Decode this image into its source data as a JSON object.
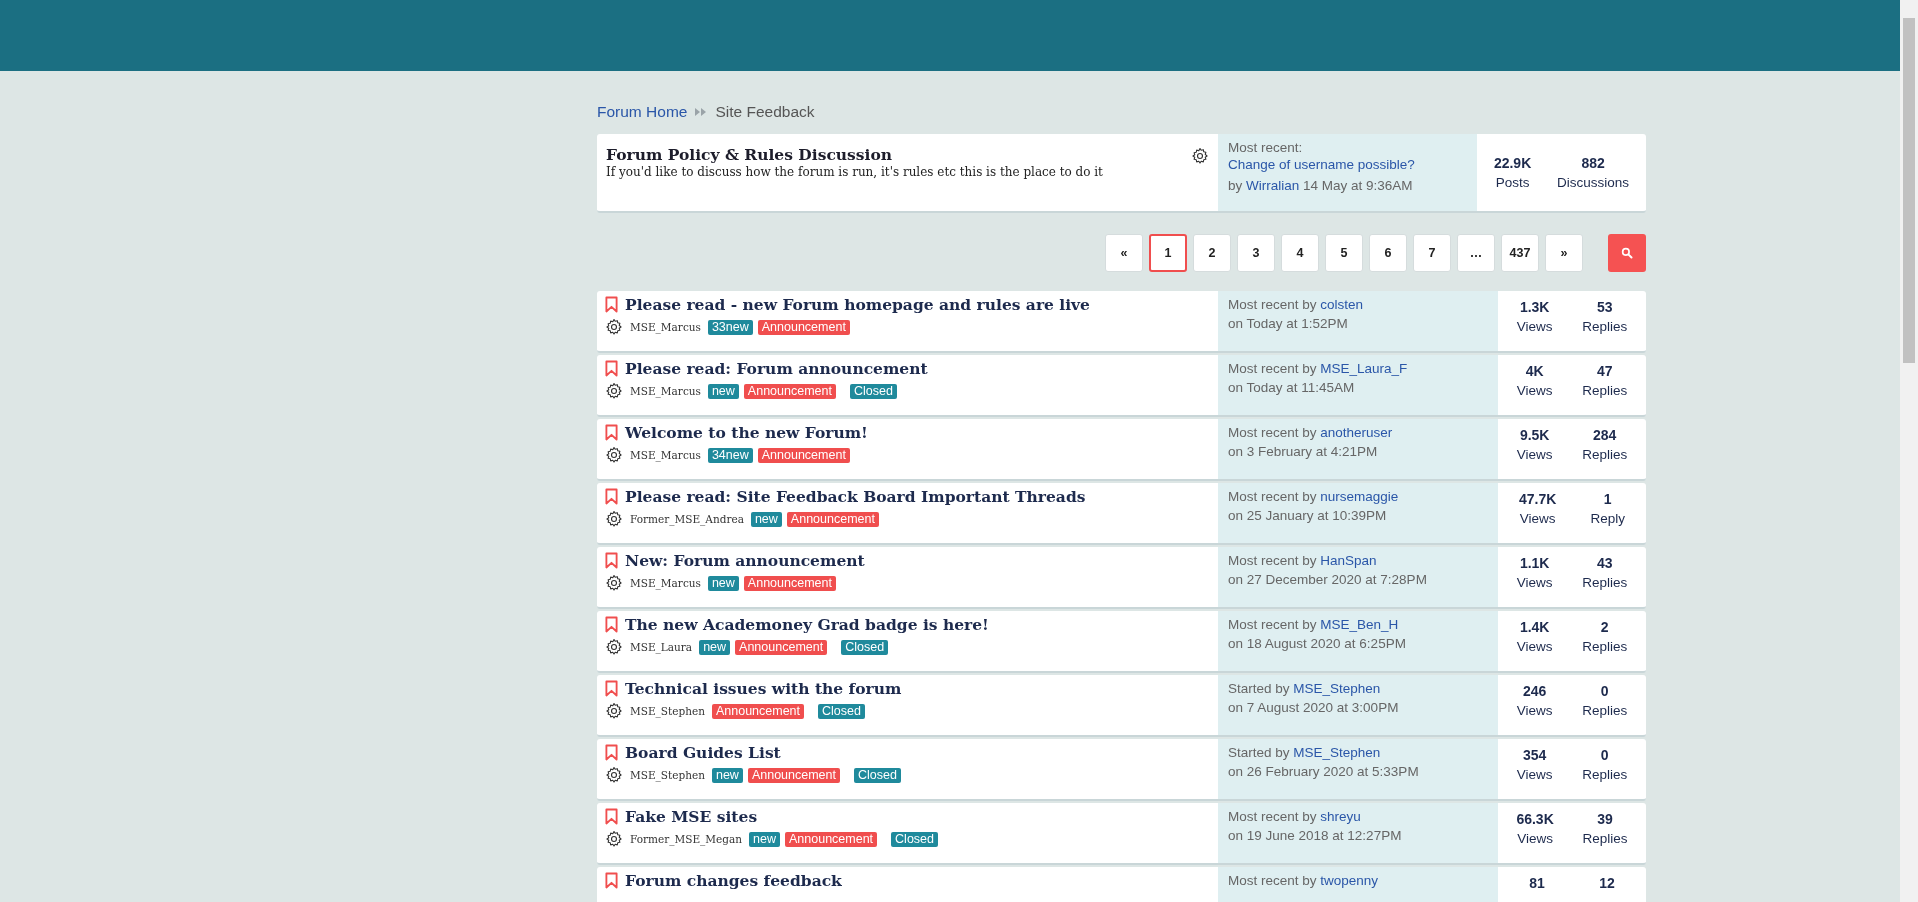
{
  "breadcrumb": [
    {
      "label": "Forum Home",
      "kind": "link"
    },
    {
      "label": "Site Feedback",
      "kind": "current"
    }
  ],
  "category": {
    "title": "Forum Policy & Rules Discussion",
    "description": "If you'd like to discuss how the forum is run, it's rules etc this is the place to do it",
    "recent_label": "Most recent:",
    "recent_link": "Change of username possible?",
    "by": "by",
    "user": "Wirralian",
    "date": "14 May at 9:36AM",
    "stats": [
      {
        "value": "22.9K",
        "label": "Posts"
      },
      {
        "value": "882",
        "label": "Discussions"
      }
    ]
  },
  "pagination": [
    {
      "label": "«",
      "selected": false
    },
    {
      "label": "1",
      "selected": true
    },
    {
      "label": "2",
      "selected": false
    },
    {
      "label": "3",
      "selected": false
    },
    {
      "label": "4",
      "selected": false
    },
    {
      "label": "5",
      "selected": false
    },
    {
      "label": "6",
      "selected": false
    },
    {
      "label": "7",
      "selected": false
    },
    {
      "label": "…",
      "selected": false
    },
    {
      "label": "437",
      "selected": false
    },
    {
      "label": "»",
      "selected": false
    }
  ],
  "threads": [
    {
      "title": "Please read - new Forum homepage and rules are live",
      "author": "MSE_Marcus",
      "tags": [
        {
          "kind": "new",
          "label": "33new"
        },
        {
          "kind": "announcement",
          "label": "Announcement"
        }
      ],
      "recent_prefix": "Most recent by",
      "recent_user": "colsten",
      "date": "on Today at 1:52PM",
      "views": "1.3K",
      "views_label": "Views",
      "replies": "53",
      "replies_label": "Replies"
    },
    {
      "title": "Please read: Forum announcement",
      "author": "MSE_Marcus",
      "tags": [
        {
          "kind": "new",
          "label": "new"
        },
        {
          "kind": "announcement",
          "label": "Announcement"
        },
        {
          "kind": "closed",
          "label": "Closed"
        }
      ],
      "recent_prefix": "Most recent by",
      "recent_user": "MSE_Laura_F",
      "date": "on Today at 11:45AM",
      "views": "4K",
      "views_label": "Views",
      "replies": "47",
      "replies_label": "Replies"
    },
    {
      "title": "Welcome to the new Forum!",
      "author": "MSE_Marcus",
      "tags": [
        {
          "kind": "new",
          "label": "34new"
        },
        {
          "kind": "announcement",
          "label": "Announcement"
        }
      ],
      "recent_prefix": "Most recent by",
      "recent_user": "anotheruser",
      "date": "on 3 February at 4:21PM",
      "views": "9.5K",
      "views_label": "Views",
      "replies": "284",
      "replies_label": "Replies"
    },
    {
      "title": "Please read: Site Feedback Board Important Threads",
      "author": "Former_MSE_Andrea",
      "tags": [
        {
          "kind": "new",
          "label": "new"
        },
        {
          "kind": "announcement",
          "label": "Announcement"
        }
      ],
      "recent_prefix": "Most recent by",
      "recent_user": "nursemaggie",
      "date": "on 25 January at 10:39PM",
      "views": "47.7K",
      "views_label": "Views",
      "replies": "1",
      "replies_label": "Reply"
    },
    {
      "title": "New: Forum announcement",
      "author": "MSE_Marcus",
      "tags": [
        {
          "kind": "new",
          "label": "new"
        },
        {
          "kind": "announcement",
          "label": "Announcement"
        }
      ],
      "recent_prefix": "Most recent by",
      "recent_user": "HanSpan",
      "date": "on 27 December 2020 at 7:28PM",
      "views": "1.1K",
      "views_label": "Views",
      "replies": "43",
      "replies_label": "Replies"
    },
    {
      "title": "The new Academoney Grad badge is here!",
      "author": "MSE_Laura",
      "tags": [
        {
          "kind": "new",
          "label": "new"
        },
        {
          "kind": "announcement",
          "label": "Announcement"
        },
        {
          "kind": "closed",
          "label": "Closed"
        }
      ],
      "recent_prefix": "Most recent by",
      "recent_user": "MSE_Ben_H",
      "date": "on 18 August 2020 at 6:25PM",
      "views": "1.4K",
      "views_label": "Views",
      "replies": "2",
      "replies_label": "Replies"
    },
    {
      "title": "Technical issues with the forum",
      "author": "MSE_Stephen",
      "tags": [
        {
          "kind": "announcement",
          "label": "Announcement"
        },
        {
          "kind": "closed",
          "label": "Closed"
        }
      ],
      "recent_prefix": "Started by",
      "recent_user": "MSE_Stephen",
      "date": "on 7 August 2020 at 3:00PM",
      "views": "246",
      "views_label": "Views",
      "replies": "0",
      "replies_label": "Replies"
    },
    {
      "title": "Board Guides List",
      "author": "MSE_Stephen",
      "tags": [
        {
          "kind": "new",
          "label": "new"
        },
        {
          "kind": "announcement",
          "label": "Announcement"
        },
        {
          "kind": "closed",
          "label": "Closed"
        }
      ],
      "recent_prefix": "Started by",
      "recent_user": "MSE_Stephen",
      "date": "on 26 February 2020 at 5:33PM",
      "views": "354",
      "views_label": "Views",
      "replies": "0",
      "replies_label": "Replies"
    },
    {
      "title": "Fake MSE sites",
      "author": "Former_MSE_Megan",
      "tags": [
        {
          "kind": "new",
          "label": "new"
        },
        {
          "kind": "announcement",
          "label": "Announcement"
        },
        {
          "kind": "closed",
          "label": "Closed"
        }
      ],
      "recent_prefix": "Most recent by",
      "recent_user": "shreyu",
      "date": "on 19 June 2018 at 12:27PM",
      "views": "66.3K",
      "views_label": "Views",
      "replies": "39",
      "replies_label": "Replies"
    },
    {
      "title": "Forum changes feedback",
      "recent_prefix": "Most recent by",
      "recent_user": "twopenny",
      "views": "81",
      "replies": "12"
    }
  ]
}
